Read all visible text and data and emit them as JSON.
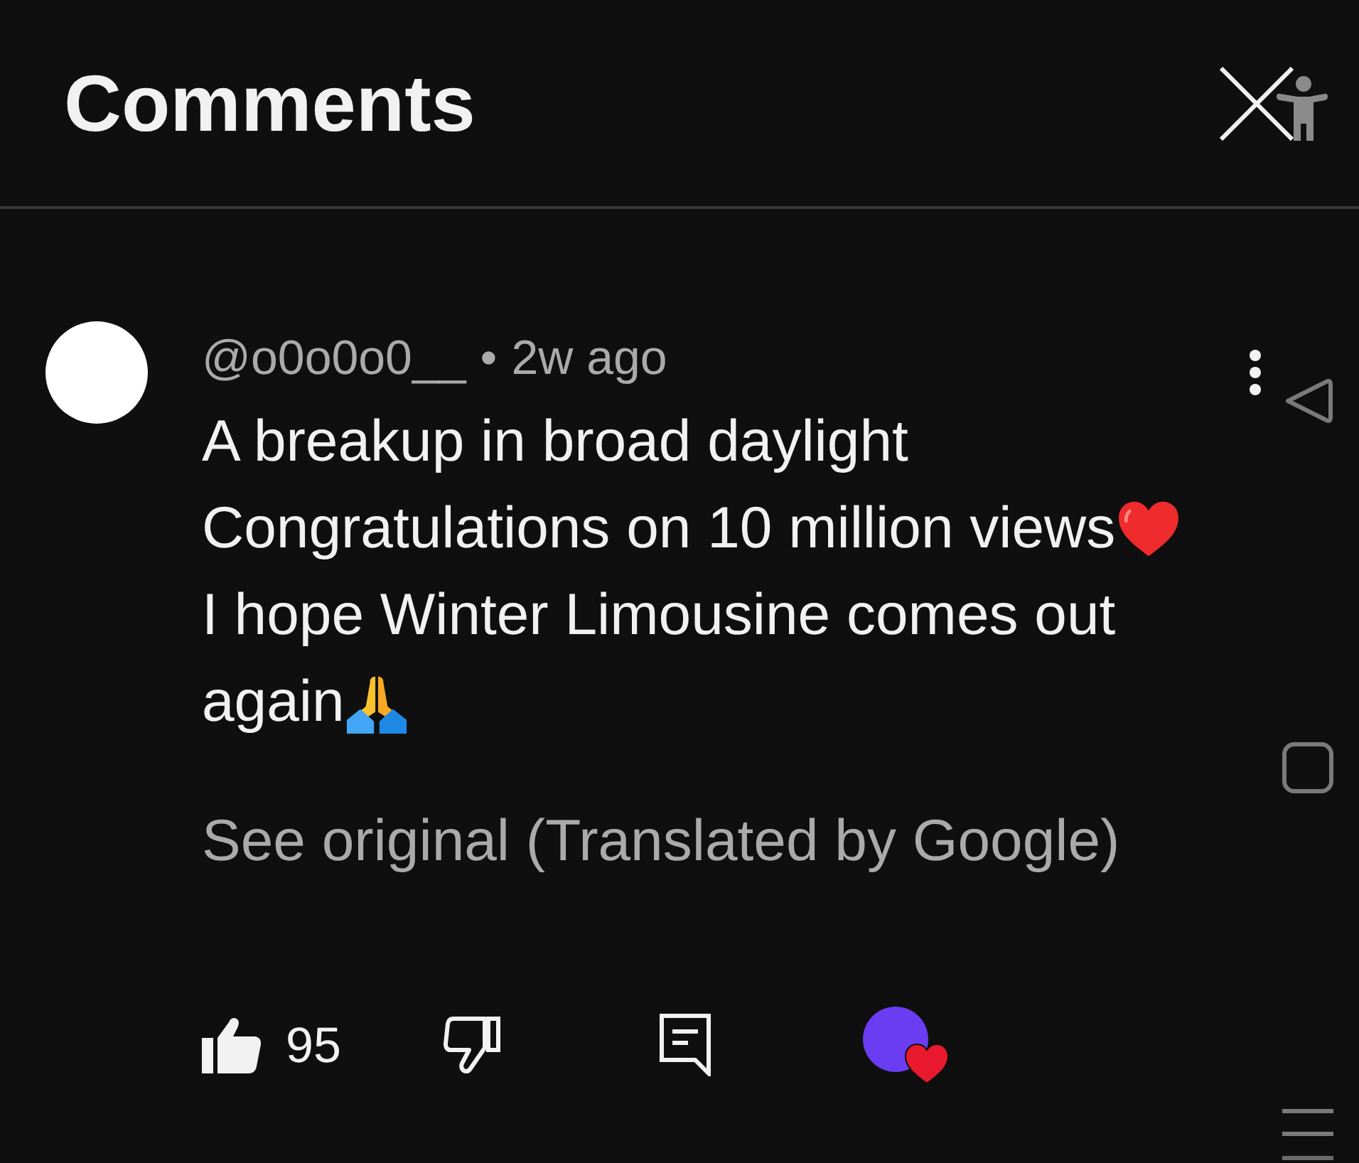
{
  "header": {
    "title": "Comments"
  },
  "comment": {
    "author": "@o0o0o0__",
    "separator": "•",
    "time": "2w ago",
    "lines": [
      {
        "kind": "plain",
        "text": "A breakup in broad daylight"
      },
      {
        "kind": "heart",
        "text": "Congratulations on 10 million views"
      },
      {
        "kind": "plain",
        "text": "I hope Winter Limousine comes out"
      },
      {
        "kind": "hands",
        "text": "again"
      }
    ],
    "translation_link": "See original (Translated by Google)",
    "likes": "95",
    "liked": true,
    "disliked": false,
    "creator_hearted": true
  }
}
